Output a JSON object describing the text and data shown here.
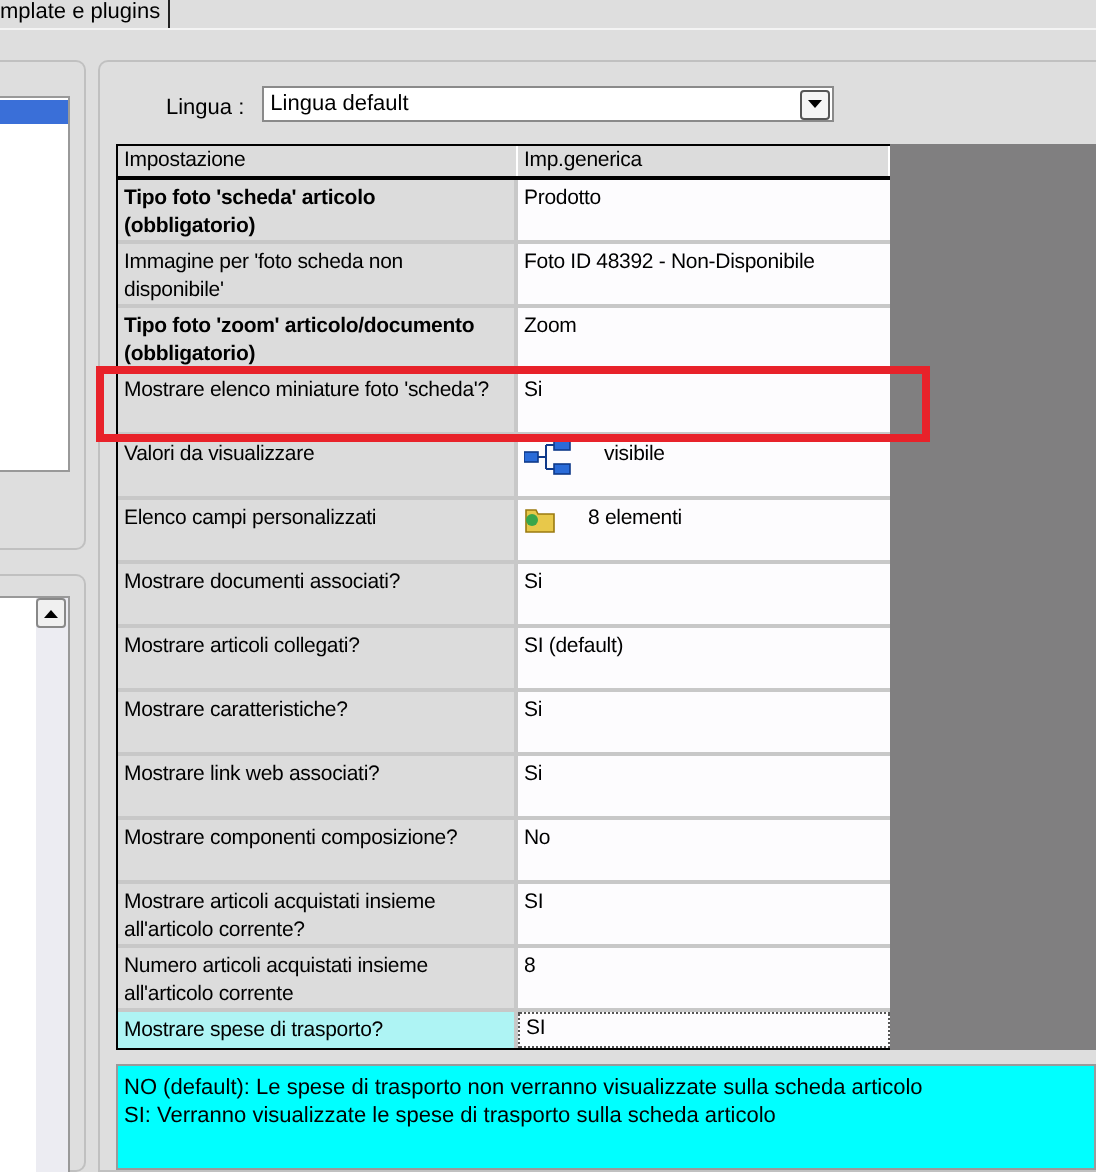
{
  "tab": {
    "label": "mplate e plugins"
  },
  "left_list": {
    "items": [
      {
        "selected": true
      }
    ]
  },
  "language": {
    "label": "Lingua :",
    "value": "Lingua default"
  },
  "table": {
    "columns": [
      "Impostazione",
      "Imp.generica"
    ],
    "rows": [
      {
        "name": "Tipo foto 'scheda' articolo (obbligatorio)",
        "bold": true,
        "kind": "text",
        "value": "Prodotto",
        "selected": false
      },
      {
        "name": "Immagine per 'foto scheda non disponibile'",
        "bold": false,
        "kind": "text",
        "value": "Foto ID 48392 - Non-Disponibile",
        "selected": false
      },
      {
        "name": "Tipo foto 'zoom' articolo/documento (obbligatorio)",
        "bold": true,
        "kind": "text",
        "value": "Zoom",
        "selected": false
      },
      {
        "name": "Mostrare elenco miniature foto 'scheda'?",
        "bold": false,
        "kind": "text",
        "value": "Si",
        "selected": false,
        "highlighted": true
      },
      {
        "name": "Valori da visualizzare",
        "bold": false,
        "kind": "tree",
        "value": "visibile",
        "selected": false
      },
      {
        "name": "Elenco campi personalizzati",
        "bold": false,
        "kind": "folder",
        "value": "8 elementi",
        "selected": false
      },
      {
        "name": "Mostrare documenti associati?",
        "bold": false,
        "kind": "text",
        "value": "Si",
        "selected": false
      },
      {
        "name": "Mostrare articoli collegati?",
        "bold": false,
        "kind": "text",
        "value": "SI (default)",
        "selected": false
      },
      {
        "name": "Mostrare caratteristiche?",
        "bold": false,
        "kind": "text",
        "value": "Si",
        "selected": false
      },
      {
        "name": "Mostrare link web associati?",
        "bold": false,
        "kind": "text",
        "value": "Si",
        "selected": false
      },
      {
        "name": "Mostrare componenti composizione?",
        "bold": false,
        "kind": "text",
        "value": "No",
        "selected": false
      },
      {
        "name": "Mostrare articoli acquistati insieme all'articolo corrente?",
        "bold": false,
        "kind": "text",
        "value": "SI",
        "selected": false
      },
      {
        "name": "Numero articoli acquistati insieme all'articolo corrente",
        "bold": false,
        "kind": "text",
        "value": "8",
        "selected": false
      },
      {
        "name": "Mostrare spese di trasporto?",
        "bold": false,
        "kind": "text",
        "value": "SI",
        "selected": true
      }
    ]
  },
  "help": {
    "lines": [
      "NO (default): Le spese di trasporto non verranno visualizzate sulla scheda articolo",
      "SI: Verranno visualizzate le spese di trasporto sulla scheda articolo"
    ]
  }
}
